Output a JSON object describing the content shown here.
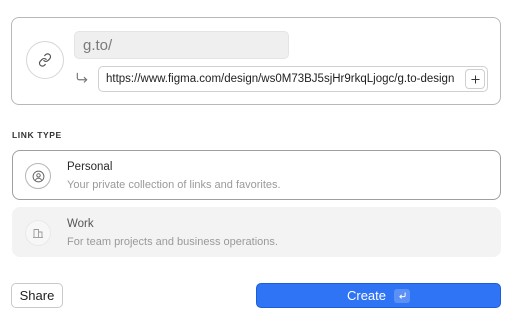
{
  "link": {
    "short_prefix": "g.to/",
    "destination_url": "https://www.figma.com/design/ws0M73BJ5sjHr9rkqLjogc/g.to-design",
    "icons": {
      "link": "link-icon",
      "redirect": "redirect-arrow-icon",
      "add": "plus-icon"
    }
  },
  "link_type": {
    "label": "LINK TYPE",
    "options": [
      {
        "title": "Personal",
        "description": "Your private collection of links and favorites.",
        "icon": "user-icon",
        "selected": true
      },
      {
        "title": "Work",
        "description": "For team projects and business operations.",
        "icon": "building-icon",
        "selected": false
      }
    ]
  },
  "actions": {
    "share_label": "Share",
    "create_label": "Create",
    "create_shortcut_icon": "enter-key-icon"
  },
  "colors": {
    "primary": "#2f74f5",
    "border": "#b8b8b8",
    "muted_text": "#9a9a9a"
  }
}
